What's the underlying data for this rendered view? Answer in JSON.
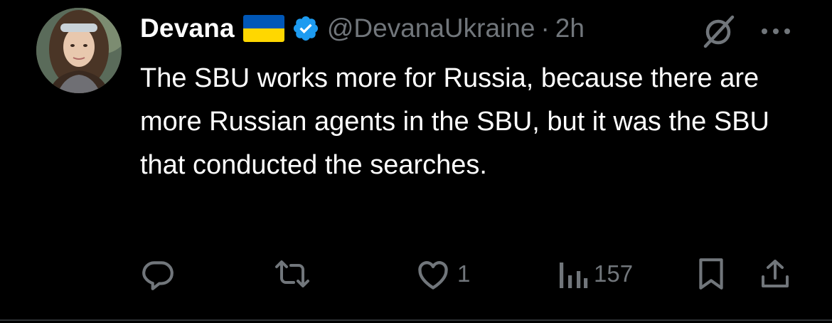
{
  "tweet": {
    "author_name": "Devana",
    "handle": "@DevanaUkraine",
    "separator": "·",
    "time": "2h",
    "text": "The SBU works more for Russia, because there are more Russian agents in the SBU, but it was the SBU that conducted the searches.",
    "likes": "1",
    "views": "157"
  },
  "icons": {
    "flag": "ukraine-flag-icon",
    "verified": "verified-badge-icon",
    "grok": "grok-icon",
    "more": "more-icon",
    "reply": "reply-icon",
    "retweet": "retweet-icon",
    "like": "like-icon",
    "views": "views-icon",
    "bookmark": "bookmark-icon",
    "share": "share-icon"
  },
  "colors": {
    "background": "#000000",
    "text": "#ffffff",
    "muted": "#71767b",
    "verified": "#1d9bf0",
    "flag_blue": "#0057b7",
    "flag_yellow": "#ffd700",
    "divider": "#2f3336"
  }
}
